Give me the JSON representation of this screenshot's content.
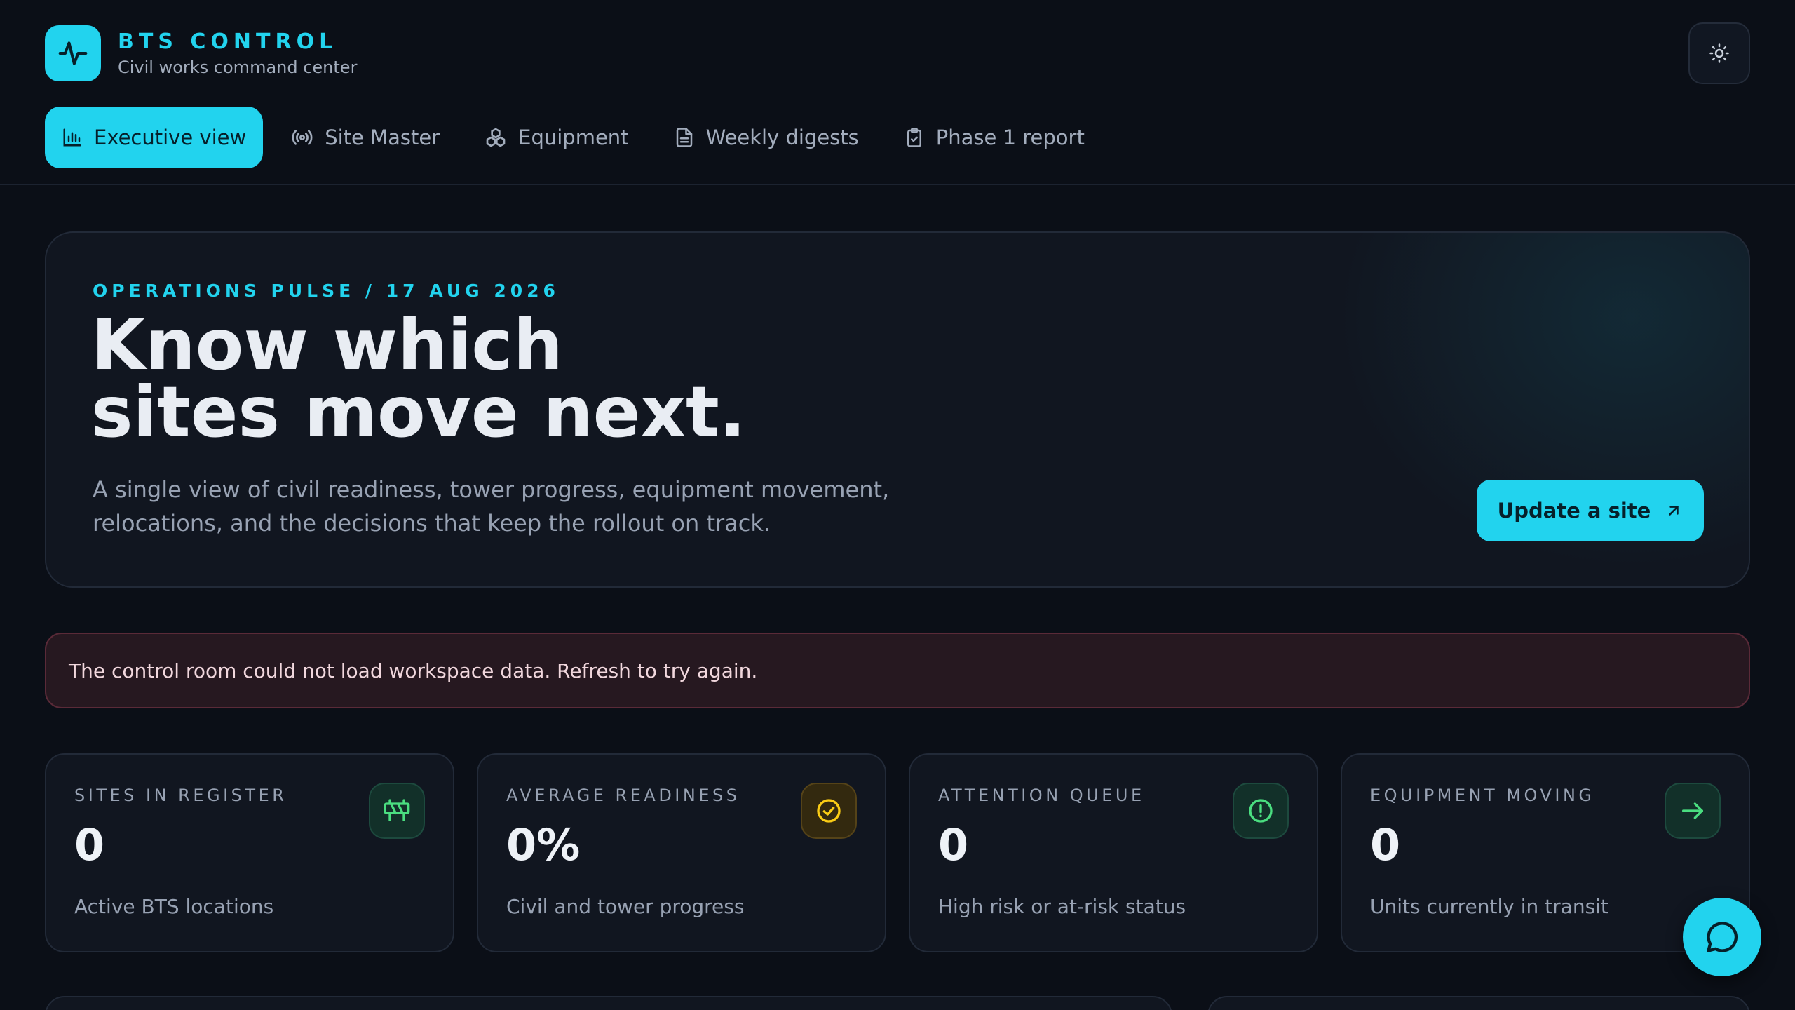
{
  "brand": {
    "title": "BTS CONTROL",
    "subtitle": "Civil works command center"
  },
  "nav": {
    "tabs": [
      {
        "label": "Executive view",
        "icon": "bar-chart-icon",
        "active": true
      },
      {
        "label": "Site Master",
        "icon": "radio-tower-icon",
        "active": false
      },
      {
        "label": "Equipment",
        "icon": "boxes-icon",
        "active": false
      },
      {
        "label": "Weekly digests",
        "icon": "document-icon",
        "active": false
      },
      {
        "label": "Phase 1 report",
        "icon": "clipboard-check-icon",
        "active": false
      }
    ]
  },
  "theme_toggle": {
    "icon": "sun-icon"
  },
  "hero": {
    "eyebrow": "OPERATIONS PULSE / 17 AUG 2026",
    "title_line1": "Know which",
    "title_line2": "sites move next.",
    "description": "A single view of civil readiness, tower progress, equipment movement, relocations, and the decisions that keep the rollout on track.",
    "cta_label": "Update a site",
    "cta_icon": "arrow-up-right-icon"
  },
  "error": {
    "message": "The control room could not load workspace data. Refresh to try again."
  },
  "stats": [
    {
      "label": "SITES IN REGISTER",
      "value": "0",
      "sub": "Active BTS locations",
      "icon": "construction-barrier-icon"
    },
    {
      "label": "AVERAGE READINESS",
      "value": "0%",
      "sub": "Civil and tower progress",
      "icon": "check-circle-icon"
    },
    {
      "label": "ATTENTION QUEUE",
      "value": "0",
      "sub": "High risk or at-risk status",
      "icon": "alert-circle-icon"
    },
    {
      "label": "EQUIPMENT MOVING",
      "value": "0",
      "sub": "Units currently in transit",
      "icon": "arrow-right-icon"
    }
  ],
  "chat": {
    "icon": "chat-bubble-icon"
  },
  "colors": {
    "accent": "#22d3ee",
    "background": "#0b0f17",
    "card": "#111620",
    "error_bg": "#261820",
    "amber": "#facc15",
    "green": "#4ade80"
  }
}
